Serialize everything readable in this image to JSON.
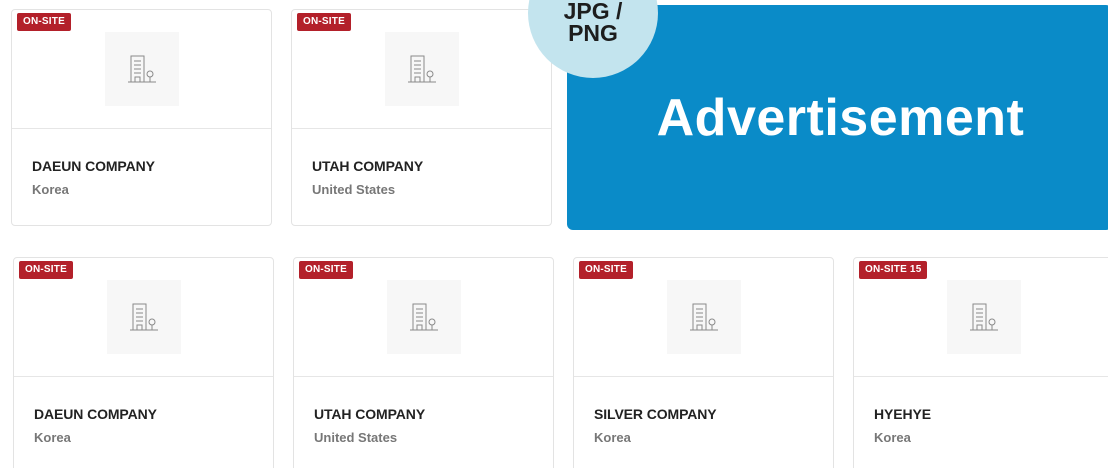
{
  "ad": {
    "label": "Advertisement",
    "format_label": "JPG / PNG",
    "bg_color": "#0a8bc8"
  },
  "badge_color": "#b3202a",
  "row1": [
    {
      "badge": "ON-SITE",
      "name": "DAEUN COMPANY",
      "country": "Korea",
      "logo": "building-icon"
    },
    {
      "badge": "ON-SITE",
      "name": "UTAH COMPANY",
      "country": "United States",
      "logo": "building-icon"
    }
  ],
  "row2": [
    {
      "badge": "ON-SITE",
      "name": "DAEUN COMPANY",
      "country": "Korea",
      "logo": "building-icon"
    },
    {
      "badge": "ON-SITE",
      "name": "UTAH COMPANY",
      "country": "United States",
      "logo": "building-icon"
    },
    {
      "badge": "ON-SITE",
      "name": "SILVER COMPANY",
      "country": "Korea",
      "logo": "building-icon"
    },
    {
      "badge": "ON-SITE 15",
      "name": "HYEHYE",
      "country": "Korea",
      "logo": "building-icon"
    }
  ]
}
